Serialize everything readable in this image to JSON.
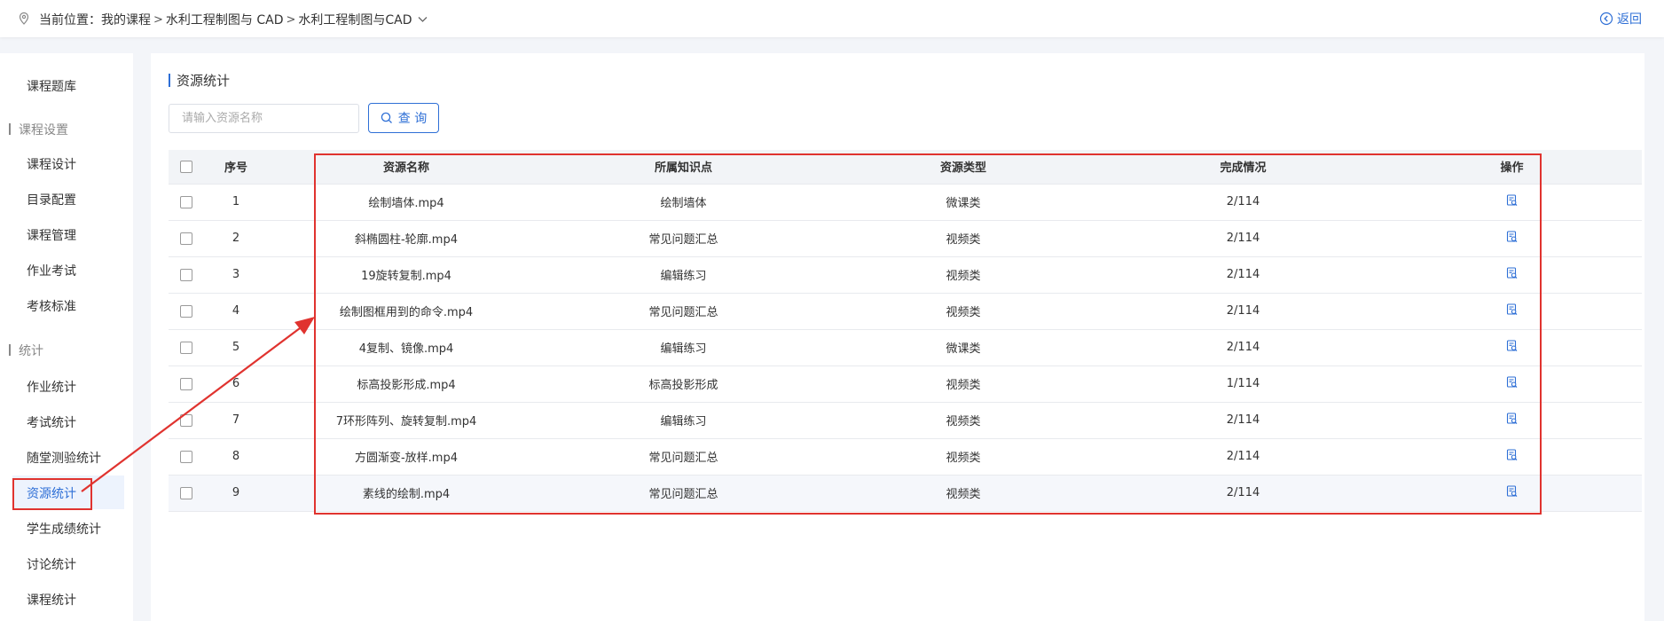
{
  "header": {
    "location_label": "当前位置：",
    "breadcrumb": [
      "我的课程",
      "水利工程制图与 CAD",
      "水利工程制图与CAD"
    ],
    "back_label": "返回"
  },
  "sidebar": {
    "items": [
      {
        "label": "课程题库",
        "type": "item"
      },
      {
        "label": "课程设置",
        "type": "group"
      },
      {
        "label": "课程设计",
        "type": "item"
      },
      {
        "label": "目录配置",
        "type": "item"
      },
      {
        "label": "课程管理",
        "type": "item"
      },
      {
        "label": "作业考试",
        "type": "item"
      },
      {
        "label": "考核标准",
        "type": "item"
      },
      {
        "label": "统计",
        "type": "group"
      },
      {
        "label": "作业统计",
        "type": "item"
      },
      {
        "label": "考试统计",
        "type": "item"
      },
      {
        "label": "随堂测验统计",
        "type": "item"
      },
      {
        "label": "资源统计",
        "type": "item",
        "active": true
      },
      {
        "label": "学生成绩统计",
        "type": "item"
      },
      {
        "label": "讨论统计",
        "type": "item"
      },
      {
        "label": "课程统计",
        "type": "item"
      }
    ]
  },
  "main": {
    "title": "资源统计",
    "search": {
      "placeholder": "请输入资源名称",
      "value": ""
    },
    "query_button": "查 询",
    "table": {
      "headers": [
        "序号",
        "资源名称",
        "所属知识点",
        "资源类型",
        "完成情况",
        "操作"
      ],
      "rows": [
        {
          "no": "1",
          "name": "绘制墙体.mp4",
          "point": "绘制墙体",
          "type": "微课类",
          "done": "2/114"
        },
        {
          "no": "2",
          "name": "斜椭圆柱-轮廓.mp4",
          "point": "常见问题汇总",
          "type": "视频类",
          "done": "2/114"
        },
        {
          "no": "3",
          "name": "19旋转复制.mp4",
          "point": "编辑练习",
          "type": "视频类",
          "done": "2/114"
        },
        {
          "no": "4",
          "name": "绘制图框用到的命令.mp4",
          "point": "常见问题汇总",
          "type": "视频类",
          "done": "2/114"
        },
        {
          "no": "5",
          "name": "4复制、镜像.mp4",
          "point": "编辑练习",
          "type": "微课类",
          "done": "2/114"
        },
        {
          "no": "6",
          "name": "标高投影形成.mp4",
          "point": "标高投影形成",
          "type": "视频类",
          "done": "1/114"
        },
        {
          "no": "7",
          "name": "7环形阵列、旋转复制.mp4",
          "point": "编辑练习",
          "type": "视频类",
          "done": "2/114"
        },
        {
          "no": "8",
          "name": "方圆渐变-放样.mp4",
          "point": "常见问题汇总",
          "type": "视频类",
          "done": "2/114"
        },
        {
          "no": "9",
          "name": "素线的绘制.mp4",
          "point": "常见问题汇总",
          "type": "视频类",
          "done": "2/114"
        }
      ]
    }
  },
  "icons": {
    "location": "location-pin-icon",
    "back": "back-arrow-icon",
    "search": "search-icon",
    "operation": "view-detail-icon"
  },
  "colors": {
    "accent": "#2e6fd6",
    "annotation": "#e0332f"
  }
}
